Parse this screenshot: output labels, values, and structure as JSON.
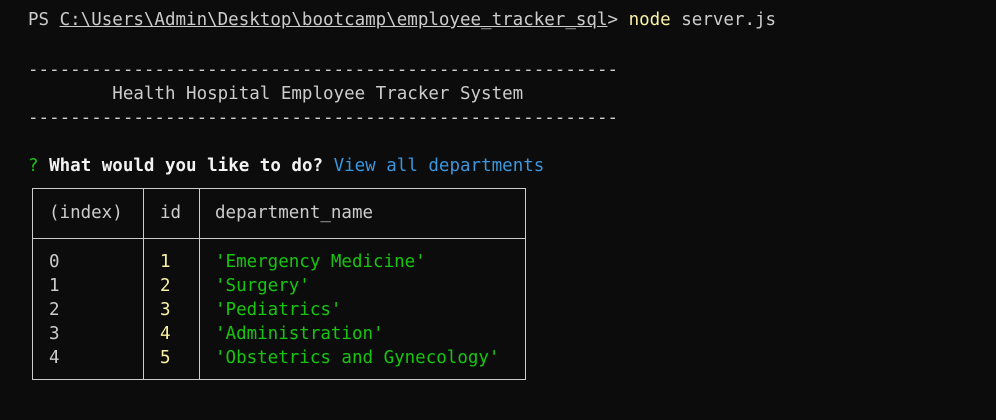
{
  "prompt": {
    "ps": "PS ",
    "path": "C:\\Users\\Admin\\Desktop\\bootcamp\\employee_tracker_sql",
    "gt": "> ",
    "command": "node",
    "argument": " server.js"
  },
  "banner": {
    "divider": "--------------------------------------------------------",
    "title": "        Health Hospital Employee Tracker System"
  },
  "question": {
    "mark": "?",
    "text": "What would you like to do?",
    "answer": "View all departments"
  },
  "table": {
    "columns": [
      "(index)",
      "id",
      "department_name"
    ],
    "rows": [
      {
        "index": "0",
        "id": "1",
        "department_name": "'Emergency Medicine'"
      },
      {
        "index": "1",
        "id": "2",
        "department_name": "'Surgery'"
      },
      {
        "index": "2",
        "id": "3",
        "department_name": "'Pediatrics'"
      },
      {
        "index": "3",
        "id": "4",
        "department_name": "'Administration'"
      },
      {
        "index": "4",
        "id": "5",
        "department_name": "'Obstetrics and Gynecology'"
      }
    ]
  },
  "colors": {
    "background": "#0c0c0c",
    "text": "#cccccc",
    "command": "#f9f1a5",
    "question_mark": "#16c60c",
    "answer": "#3a96dd",
    "number": "#f9f1a5",
    "string": "#16c60c"
  }
}
